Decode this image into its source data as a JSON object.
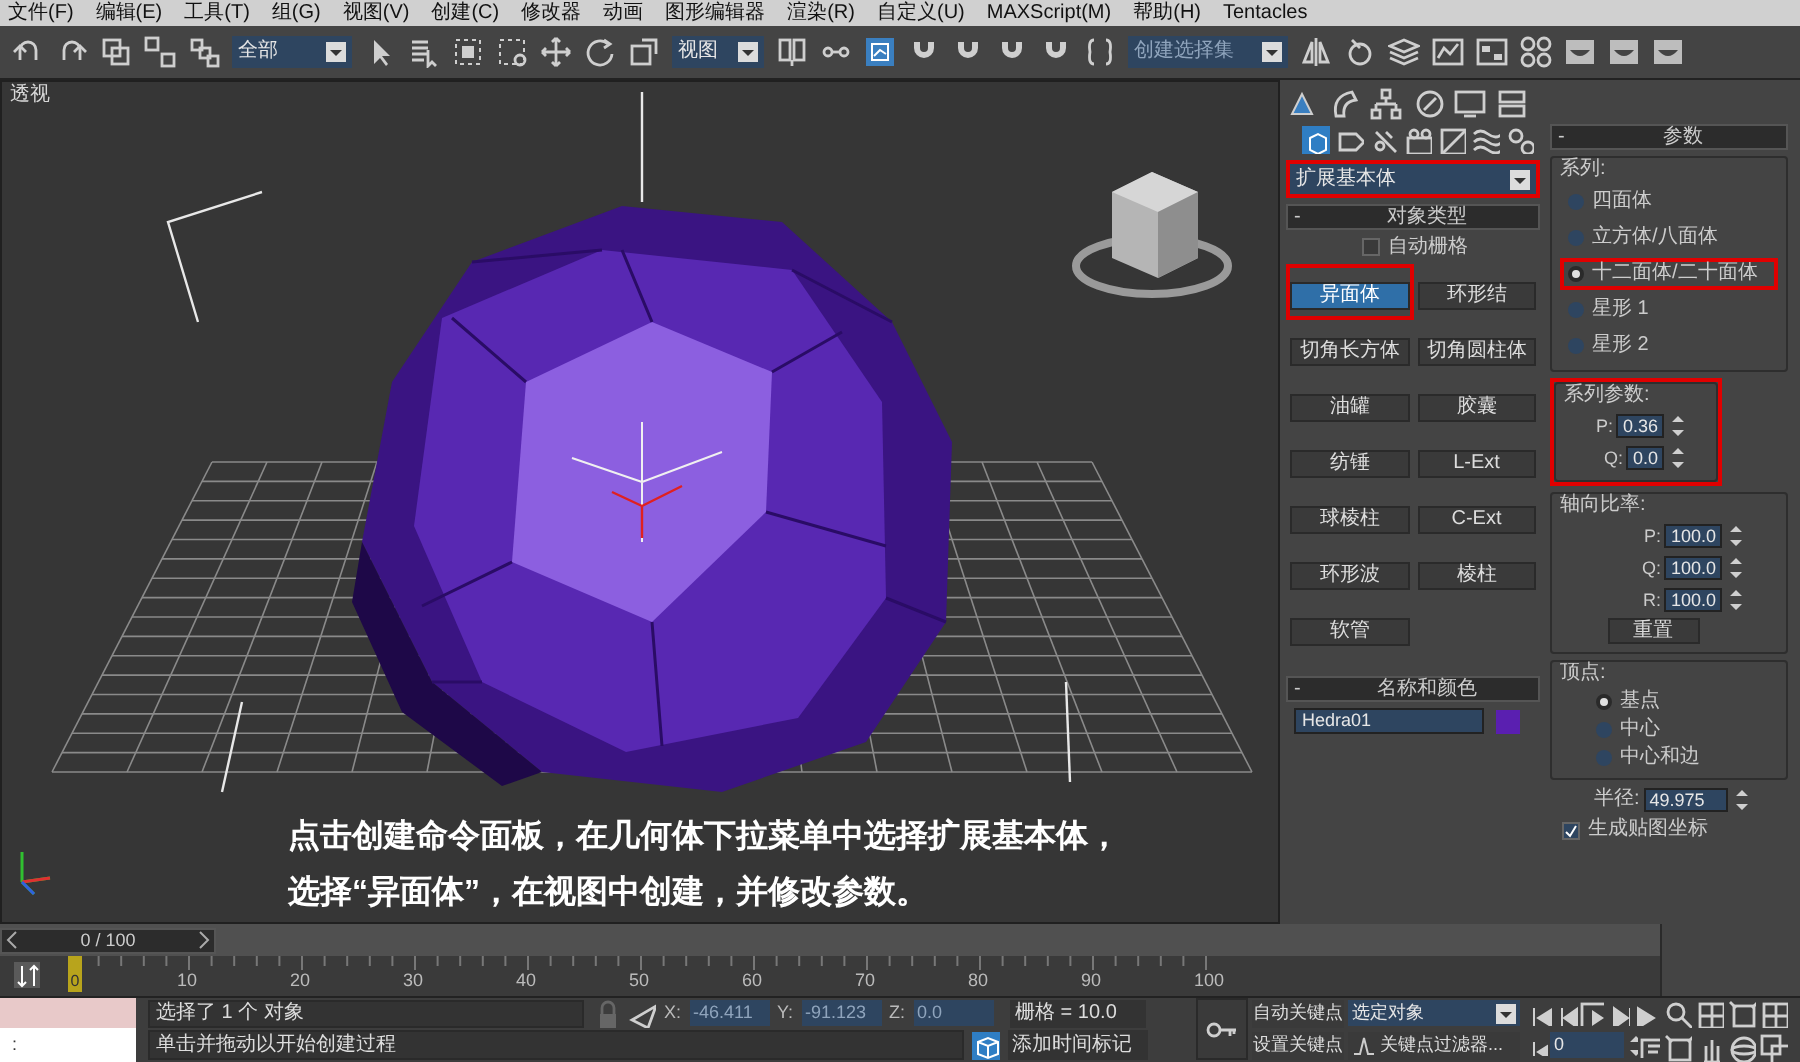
{
  "menu": [
    "文件(F)",
    "编辑(E)",
    "工具(T)",
    "组(G)",
    "视图(V)",
    "创建(C)",
    "修改器",
    "动画",
    "图形编辑器",
    "渲染(R)",
    "自定义(U)",
    "MAXScript(M)",
    "帮助(H)",
    "Tentacles"
  ],
  "toolbar": {
    "selection_filter": "全部",
    "reference_coord": "视图",
    "selection_set": "创建选择集"
  },
  "viewport": {
    "label": "透视",
    "caption": [
      "点击创建命令面板，在几何体下拉菜单中选择扩展基本体，",
      "选择“异面体”，在视图中创建，并修改参数。"
    ]
  },
  "command_panel": {
    "category": {
      "value": "扩展基本体",
      "highlighted": true
    },
    "object_type": {
      "collapse": "-",
      "title": "对象类型",
      "autogrid": {
        "label": "自动栅格",
        "checked": false
      },
      "buttons": [
        {
          "label": "异面体",
          "selected": true,
          "highlighted": true
        },
        {
          "label": "环形结",
          "selected": false,
          "highlighted": false
        },
        {
          "label": "切角长方体",
          "selected": false,
          "highlighted": false
        },
        {
          "label": "切角圆柱体",
          "selected": false,
          "highlighted": false
        },
        {
          "label": "油罐",
          "selected": false,
          "highlighted": false
        },
        {
          "label": "胶囊",
          "selected": false,
          "highlighted": false
        },
        {
          "label": "纺锤",
          "selected": false,
          "highlighted": false
        },
        {
          "label": "L-Ext",
          "selected": false,
          "highlighted": false
        },
        {
          "label": "球棱柱",
          "selected": false,
          "highlighted": false
        },
        {
          "label": "C-Ext",
          "selected": false,
          "highlighted": false
        },
        {
          "label": "环形波",
          "selected": false,
          "highlighted": false
        },
        {
          "label": "棱柱",
          "selected": false,
          "highlighted": false
        },
        {
          "label": "软管",
          "selected": false,
          "highlighted": false
        }
      ]
    },
    "name_color": {
      "collapse": "-",
      "title": "名称和颜色",
      "name": "Hedra01",
      "color": "#5a1fb0"
    },
    "parameters": {
      "collapse": "-",
      "title": "参数",
      "family": {
        "title": "系列:",
        "options": [
          {
            "label": "四面体",
            "selected": false,
            "highlighted": false
          },
          {
            "label": "立方体/八面体",
            "selected": false,
            "highlighted": false
          },
          {
            "label": "十二面体/二十面体",
            "selected": true,
            "highlighted": true
          },
          {
            "label": "星形 1",
            "selected": false,
            "highlighted": false
          },
          {
            "label": "星形 2",
            "selected": false,
            "highlighted": false
          }
        ]
      },
      "family_params": {
        "title": "系列参数:",
        "highlighted": true,
        "fields": [
          {
            "label": "P:",
            "value": "0.36"
          },
          {
            "label": "Q:",
            "value": "0.0"
          }
        ]
      },
      "axis_scaling": {
        "title": "轴向比率:",
        "fields": [
          {
            "label": "P:",
            "value": "100.0"
          },
          {
            "label": "Q:",
            "value": "100.0"
          },
          {
            "label": "R:",
            "value": "100.0"
          }
        ],
        "reset": "重置"
      },
      "vertices": {
        "title": "顶点:",
        "options": [
          {
            "label": "基点",
            "selected": true
          },
          {
            "label": "中心",
            "selected": false
          },
          {
            "label": "中心和边",
            "selected": false
          }
        ]
      },
      "radius": {
        "label": "半径:",
        "value": "49.975"
      },
      "mapping": {
        "label": "生成贴图坐标",
        "checked": true
      }
    }
  },
  "time_slider": {
    "frame": "0 / 100",
    "level": 0,
    "current": "0",
    "ticks": [
      "10",
      "20",
      "30",
      "40",
      "50",
      "60",
      "70",
      "80",
      "90",
      "100"
    ]
  },
  "status_bar": {
    "maxscript": ":",
    "selection": "选择了 1 个 对象",
    "prompt": "单击并拖动以开始创建过程",
    "coords": [
      {
        "label": "X:",
        "value": "-46.411"
      },
      {
        "label": "Y:",
        "value": "-91.123"
      },
      {
        "label": "Z:",
        "value": "0.0"
      }
    ],
    "grid": "栅格 = 10.0",
    "add_time_tag": "添加时间标记",
    "auto_key": "自动关键点",
    "set_key": "设置关键点",
    "key_mode": "选定对象",
    "key_filters": "关键点过滤器...",
    "frame": "0"
  }
}
